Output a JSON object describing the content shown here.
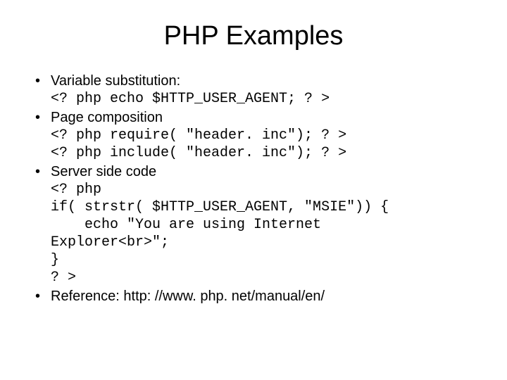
{
  "title": "PHP Examples",
  "items": [
    {
      "heading": "Variable substitution:",
      "code": "<? php echo $HTTP_USER_AGENT; ? >"
    },
    {
      "heading": "Page composition",
      "code": "<? php require( \"header. inc\"); ? >\n<? php include( \"header. inc\"); ? >"
    },
    {
      "heading": "Server side code",
      "code": "<? php\nif( strstr( $HTTP_USER_AGENT, \"MSIE\")) {\n    echo \"You are using Internet\nExplorer<br>\";\n}\n? >"
    },
    {
      "heading": "Reference: http: //www. php. net/manual/en/",
      "code": ""
    }
  ]
}
